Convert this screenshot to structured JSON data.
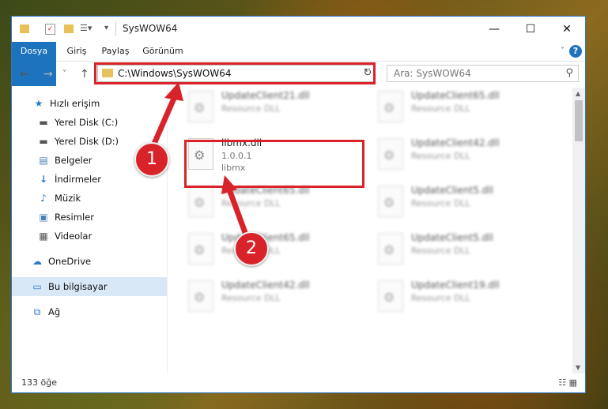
{
  "window": {
    "title": "SysWOW64",
    "controls": {
      "minimize": "—",
      "maximize": "☐",
      "close": "✕"
    }
  },
  "ribbon": {
    "tabs": [
      {
        "label": "Dosya",
        "active": true
      },
      {
        "label": "Giriş"
      },
      {
        "label": "Paylaş"
      },
      {
        "label": "Görünüm"
      }
    ],
    "help": "?"
  },
  "nav": {
    "back": "←",
    "forward": "→",
    "dropdown": "˅",
    "up": "↑"
  },
  "address": {
    "path": "C:\\Windows\\SysWOW64",
    "dropdown": "˅",
    "refresh": "↻"
  },
  "search": {
    "placeholder": "Ara: SysWOW64",
    "icon": "⚲"
  },
  "sidebar": {
    "items": [
      {
        "label": "Hızlı erişim",
        "icon": "★"
      },
      {
        "label": "Yerel Disk (C:)",
        "icon": "▬"
      },
      {
        "label": "Yerel Disk (D:)",
        "icon": "▬"
      },
      {
        "label": "Belgeler",
        "icon": "▤"
      },
      {
        "label": "İndirmeler",
        "icon": "↓",
        "pinned": true
      },
      {
        "label": "Müzik",
        "icon": "♪",
        "pinned": true
      },
      {
        "label": "Resimler",
        "icon": "▣",
        "pinned": true
      },
      {
        "label": "Videolar",
        "icon": "▦",
        "pinned": true
      },
      {
        "label": "OneDrive",
        "icon": "☁"
      },
      {
        "label": "Bu bilgisayar",
        "icon": "▭",
        "selected": true
      },
      {
        "label": "Ağ",
        "icon": "⧉"
      }
    ],
    "pin_icon": "📌"
  },
  "files": [
    {
      "name": "UpdateClient21.dll",
      "line2": "Resource DLL",
      "line3": ""
    },
    {
      "name": "UpdateClient65.dll",
      "line2": "Resource DLL",
      "line3": ""
    },
    {
      "name": "libmx.dll",
      "line2": "1.0.0.1",
      "line3": "libmx"
    },
    {
      "name": "UpdateClient42.dll",
      "line2": "Resource DLL",
      "line3": ""
    },
    {
      "name": "UpdateClient65.dll",
      "line2": "Resource DLL",
      "line3": ""
    },
    {
      "name": "UpdateClient5.dll",
      "line2": "Resource DLL",
      "line3": ""
    },
    {
      "name": "UpdateClient65.dll",
      "line2": "Resource DLL",
      "line3": ""
    },
    {
      "name": "UpdateClient5.dll",
      "line2": "Resource DLL",
      "line3": ""
    },
    {
      "name": "UpdateClient42.dll",
      "line2": "Resource DLL",
      "line3": ""
    },
    {
      "name": "UpdateClient19.dll",
      "line2": "Resource DLL",
      "line3": ""
    }
  ],
  "status": {
    "count": "133 öğe",
    "views": "☷ ▦"
  },
  "annotations": {
    "badge1": "1",
    "badge2": "2",
    "accent": "#d9232b"
  }
}
